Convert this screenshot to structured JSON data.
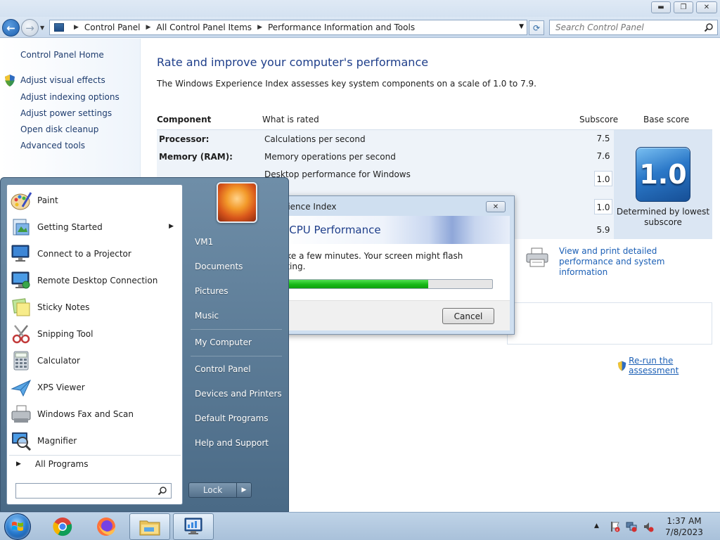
{
  "address": {
    "breadcrumb": [
      "Control Panel",
      "All Control Panel Items",
      "Performance Information and Tools"
    ],
    "search_placeholder": "Search Control Panel"
  },
  "left_pane": {
    "home": "Control Panel Home",
    "links": [
      "Adjust visual effects",
      "Adjust indexing options",
      "Adjust power settings",
      "Open disk cleanup",
      "Advanced tools"
    ]
  },
  "main": {
    "title": "Rate and improve your computer's performance",
    "description": "The Windows Experience Index assesses key system components on a scale of 1.0 to 7.9.",
    "columns": {
      "component": "Component",
      "what": "What is rated",
      "subscore": "Subscore",
      "base": "Base score"
    },
    "rows": [
      {
        "component": "Processor:",
        "what": "Calculations per second",
        "subscore": "7.5"
      },
      {
        "component": "Memory (RAM):",
        "what": "Memory operations per second",
        "subscore": "7.6"
      },
      {
        "component": "",
        "what": "Desktop performance for Windows",
        "subscore": "1.0"
      },
      {
        "component": "",
        "what": "",
        "subscore": "1.0"
      },
      {
        "component": "",
        "what": "",
        "subscore": "5.9"
      }
    ],
    "base_score": "1.0",
    "base_caption": "Determined by lowest subscore",
    "print_link": "View and print detailed performance and system information",
    "rerun_link": "Re-run the assessment"
  },
  "dialog": {
    "title": "erience Index",
    "heading": "g CPU Performance",
    "message": "ake a few minutes. Your screen might flash\nating.",
    "progress": 0.7,
    "cancel": "Cancel"
  },
  "start_menu": {
    "pinned": [
      {
        "label": "Paint",
        "icon": "paint-icon"
      },
      {
        "label": "Getting Started",
        "icon": "getting-started-icon",
        "arrow": true
      },
      {
        "label": "Connect to a Projector",
        "icon": "projector-icon"
      },
      {
        "label": "Remote Desktop Connection",
        "icon": "remote-desktop-icon"
      },
      {
        "label": "Sticky Notes",
        "icon": "sticky-notes-icon"
      },
      {
        "label": "Snipping Tool",
        "icon": "snipping-tool-icon"
      },
      {
        "label": "Calculator",
        "icon": "calculator-icon"
      },
      {
        "label": "XPS Viewer",
        "icon": "xps-viewer-icon"
      },
      {
        "label": "Windows Fax and Scan",
        "icon": "fax-scan-icon"
      },
      {
        "label": "Magnifier",
        "icon": "magnifier-icon"
      }
    ],
    "all_programs": "All Programs",
    "right_items": [
      "VM1",
      "Documents",
      "Pictures",
      "Music",
      "My Computer",
      "Control Panel",
      "Devices and Printers",
      "Default Programs",
      "Help and Support"
    ],
    "lock": "Lock"
  },
  "taskbar": {
    "time": "1:37 AM",
    "date": "7/8/2023"
  }
}
